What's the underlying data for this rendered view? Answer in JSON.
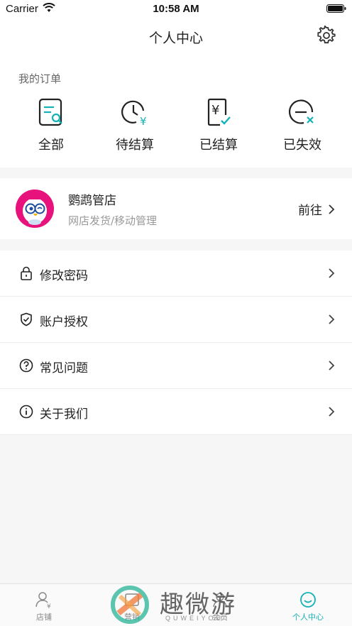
{
  "status_bar": {
    "carrier": "Carrier",
    "time": "10:58 AM"
  },
  "nav": {
    "title": "个人中心"
  },
  "orders": {
    "title": "我的订单",
    "items": [
      {
        "label": "全部",
        "icon": "all-orders-icon"
      },
      {
        "label": "待结算",
        "icon": "pending-settlement-icon"
      },
      {
        "label": "已结算",
        "icon": "settled-icon"
      },
      {
        "label": "已失效",
        "icon": "expired-icon"
      }
    ]
  },
  "shop": {
    "name": "鹦鹉管店",
    "subtitle": "网店发货/移动管理",
    "action": "前往"
  },
  "menu": [
    {
      "label": "修改密码",
      "icon": "lock-icon"
    },
    {
      "label": "账户授权",
      "icon": "shield-check-icon"
    },
    {
      "label": "常见问题",
      "icon": "question-icon"
    },
    {
      "label": "关于我们",
      "icon": "info-icon"
    }
  ],
  "tabs": [
    {
      "label": "店铺",
      "icon": "shop-user-icon",
      "active": false
    },
    {
      "label": "营销",
      "icon": "marketing-icon",
      "active": false
    },
    {
      "label": "会员",
      "icon": "member-icon",
      "active": false
    },
    {
      "label": "个人中心",
      "icon": "smile-icon",
      "active": true
    }
  ],
  "watermark": {
    "text": "趣微游",
    "sub": "QUWEIYOU"
  },
  "colors": {
    "accent": "#14b2b7",
    "text_primary": "#222222",
    "text_secondary": "#999999",
    "background": "#f6f6f6"
  }
}
